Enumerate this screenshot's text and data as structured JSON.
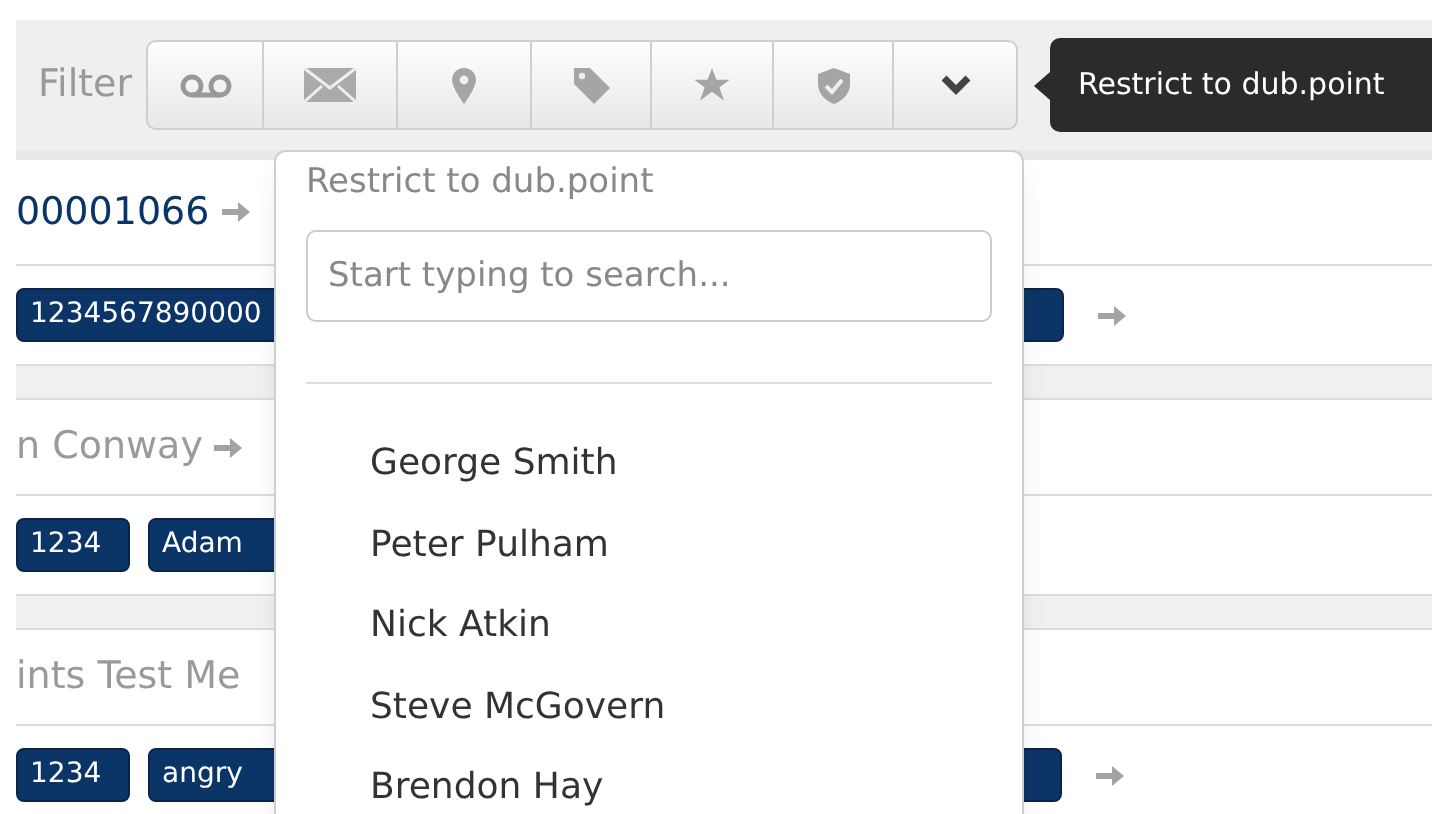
{
  "filter": {
    "label": "Filter"
  },
  "tooltip": {
    "text": "Restrict to dub.point"
  },
  "groups": [
    {
      "title": {
        "text": "00001066",
        "muted": false,
        "arrow": true
      },
      "tags": [
        "1234567890000"
      ],
      "trailing_tag": true,
      "arrow": true
    },
    {
      "title": {
        "text": "n Conway",
        "muted": true,
        "arrow": true
      },
      "tags": [
        "1234",
        "Adam"
      ],
      "trailing_tag": false,
      "arrow": false
    },
    {
      "title": {
        "text": "ints Test Me",
        "muted": true,
        "arrow": false
      },
      "tags": [
        "1234",
        "angry"
      ],
      "trailing_tag": true,
      "arrow": true
    }
  ],
  "popup": {
    "title": "Restrict to dub.point",
    "search": {
      "placeholder": "Start typing to search..."
    },
    "options": [
      "George Smith",
      "Peter Pulham",
      "Nick Atkin",
      "Steve McGovern",
      "Brendon Hay"
    ]
  }
}
